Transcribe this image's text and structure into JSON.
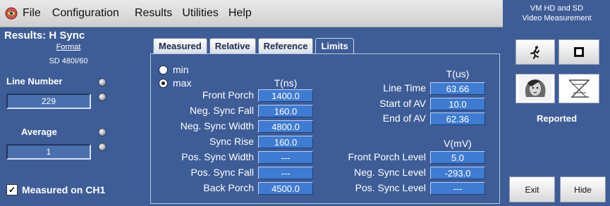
{
  "menu": {
    "items": [
      "File",
      "Configuration",
      "Results",
      "Utilities",
      "Help"
    ],
    "app_icon": "tektronix-app-icon"
  },
  "left": {
    "title": "Results: H Sync",
    "format_label": "Format",
    "format_value": "SD 480I/60",
    "line_number_label": "Line Number",
    "line_number_value": "229",
    "average_label": "Average",
    "average_value": "1",
    "measured_on": "Measured on CH1",
    "measured_on_checked": true
  },
  "tabs": [
    {
      "label": "Measured",
      "active": false
    },
    {
      "label": "Relative",
      "active": false
    },
    {
      "label": "Reference",
      "active": false
    },
    {
      "label": "Limits",
      "active": true
    }
  ],
  "mode": {
    "options": [
      {
        "label": "min",
        "selected": false
      },
      {
        "label": "max",
        "selected": true
      }
    ]
  },
  "columns": {
    "tns": "T(ns)",
    "tus": "T(us)",
    "vmv": "V(mV)"
  },
  "timing_ns": [
    {
      "label": "Front Porch",
      "value": "1400.0"
    },
    {
      "label": "Neg. Sync Fall",
      "value": "160.0"
    },
    {
      "label": "Neg. Sync Width",
      "value": "4800.0"
    },
    {
      "label": "Sync Rise",
      "value": "160.0"
    },
    {
      "label": "Pos. Sync Width",
      "value": "---"
    },
    {
      "label": "Pos. Sync Fall",
      "value": "---"
    },
    {
      "label": "Back Porch",
      "value": "4500.0"
    }
  ],
  "timing_us": [
    {
      "label": "Line Time",
      "value": "63.66"
    },
    {
      "label": "Start of AV",
      "value": "10.0"
    },
    {
      "label": "End of AV",
      "value": "62.36"
    }
  ],
  "levels_mv": [
    {
      "label": "Front Porch Level",
      "value": "5.0"
    },
    {
      "label": "Neg. Sync Level",
      "value": "-293.0"
    },
    {
      "label": "Pos. Sync Level",
      "value": "---"
    }
  ],
  "right": {
    "title_line1": "VM HD and SD",
    "title_line2": "Video Measurement",
    "reported": "Reported",
    "exit_label": "Exit",
    "hide_label": "Hide",
    "icons": [
      "running-man-icon",
      "stop-square-icon",
      "face-image-icon",
      "hourglass-waveform-icon"
    ]
  },
  "colors": {
    "panel_bg": "#3e5d97",
    "value_bg": "#3f7bd0",
    "menubar_bg": "#dcdcdc"
  }
}
